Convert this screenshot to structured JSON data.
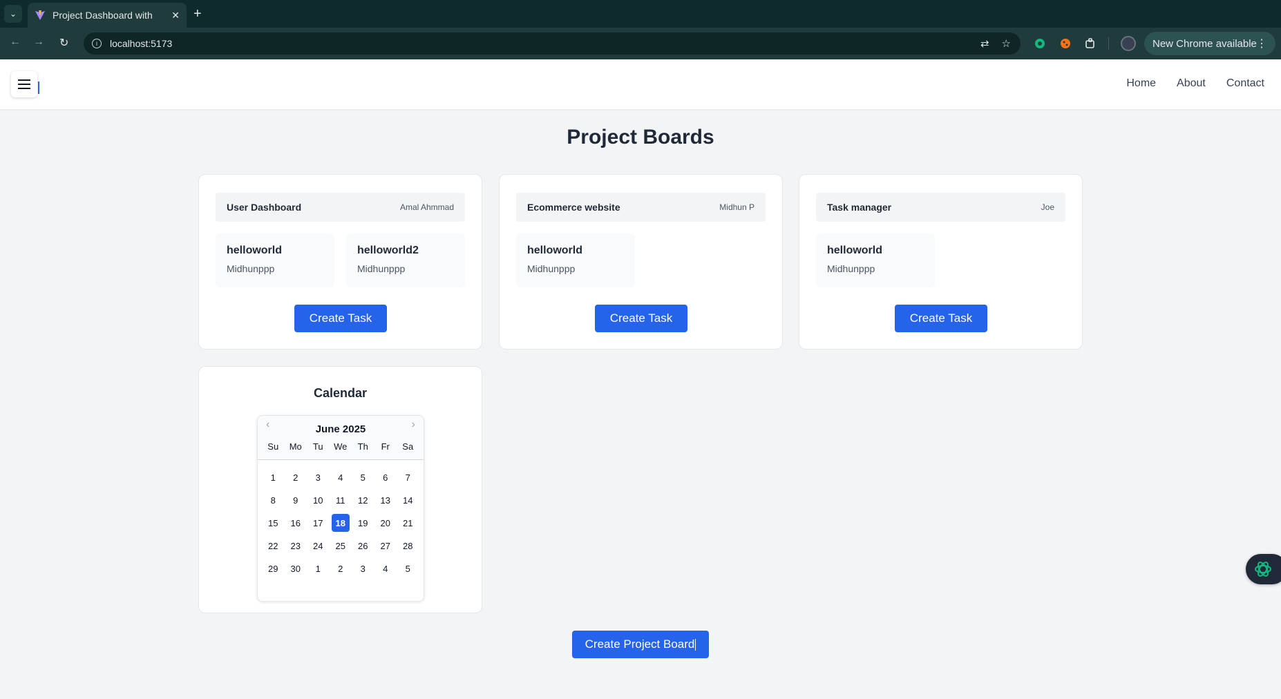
{
  "browser": {
    "tab_title": "Project Dashboard with ",
    "url": "localhost:5173",
    "update_label": "New Chrome available"
  },
  "header": {
    "nav": [
      "Home",
      "About",
      "Contact"
    ]
  },
  "page": {
    "title": "Project Boards"
  },
  "boards": [
    {
      "name": "User Dashboard",
      "owner": "Amal Ahmmad",
      "tasks": [
        {
          "title": "helloworld",
          "user": "Midhunppp"
        },
        {
          "title": "helloworld2",
          "user": "Midhunppp"
        }
      ],
      "button": "Create Task"
    },
    {
      "name": "Ecommerce website",
      "owner": "Midhun P",
      "tasks": [
        {
          "title": "helloworld",
          "user": "Midhunppp"
        }
      ],
      "button": "Create Task"
    },
    {
      "name": "Task manager",
      "owner": "Joe",
      "tasks": [
        {
          "title": "helloworld",
          "user": "Midhunppp"
        }
      ],
      "button": "Create Task"
    }
  ],
  "calendar": {
    "title": "Calendar",
    "month_label": "June 2025",
    "weekdays": [
      "Su",
      "Mo",
      "Tu",
      "We",
      "Th",
      "Fr",
      "Sa"
    ],
    "days": [
      "1",
      "2",
      "3",
      "4",
      "5",
      "6",
      "7",
      "8",
      "9",
      "10",
      "11",
      "12",
      "13",
      "14",
      "15",
      "16",
      "17",
      "18",
      "19",
      "20",
      "21",
      "22",
      "23",
      "24",
      "25",
      "26",
      "27",
      "28",
      "29",
      "30",
      "1",
      "2",
      "3",
      "4",
      "5"
    ],
    "selected_day": "18"
  },
  "actions": {
    "create_board": "Create Project Board"
  },
  "colors": {
    "accent": "#2563eb",
    "page_bg": "#f3f4f6",
    "chrome_bg": "#1f3b3b"
  }
}
